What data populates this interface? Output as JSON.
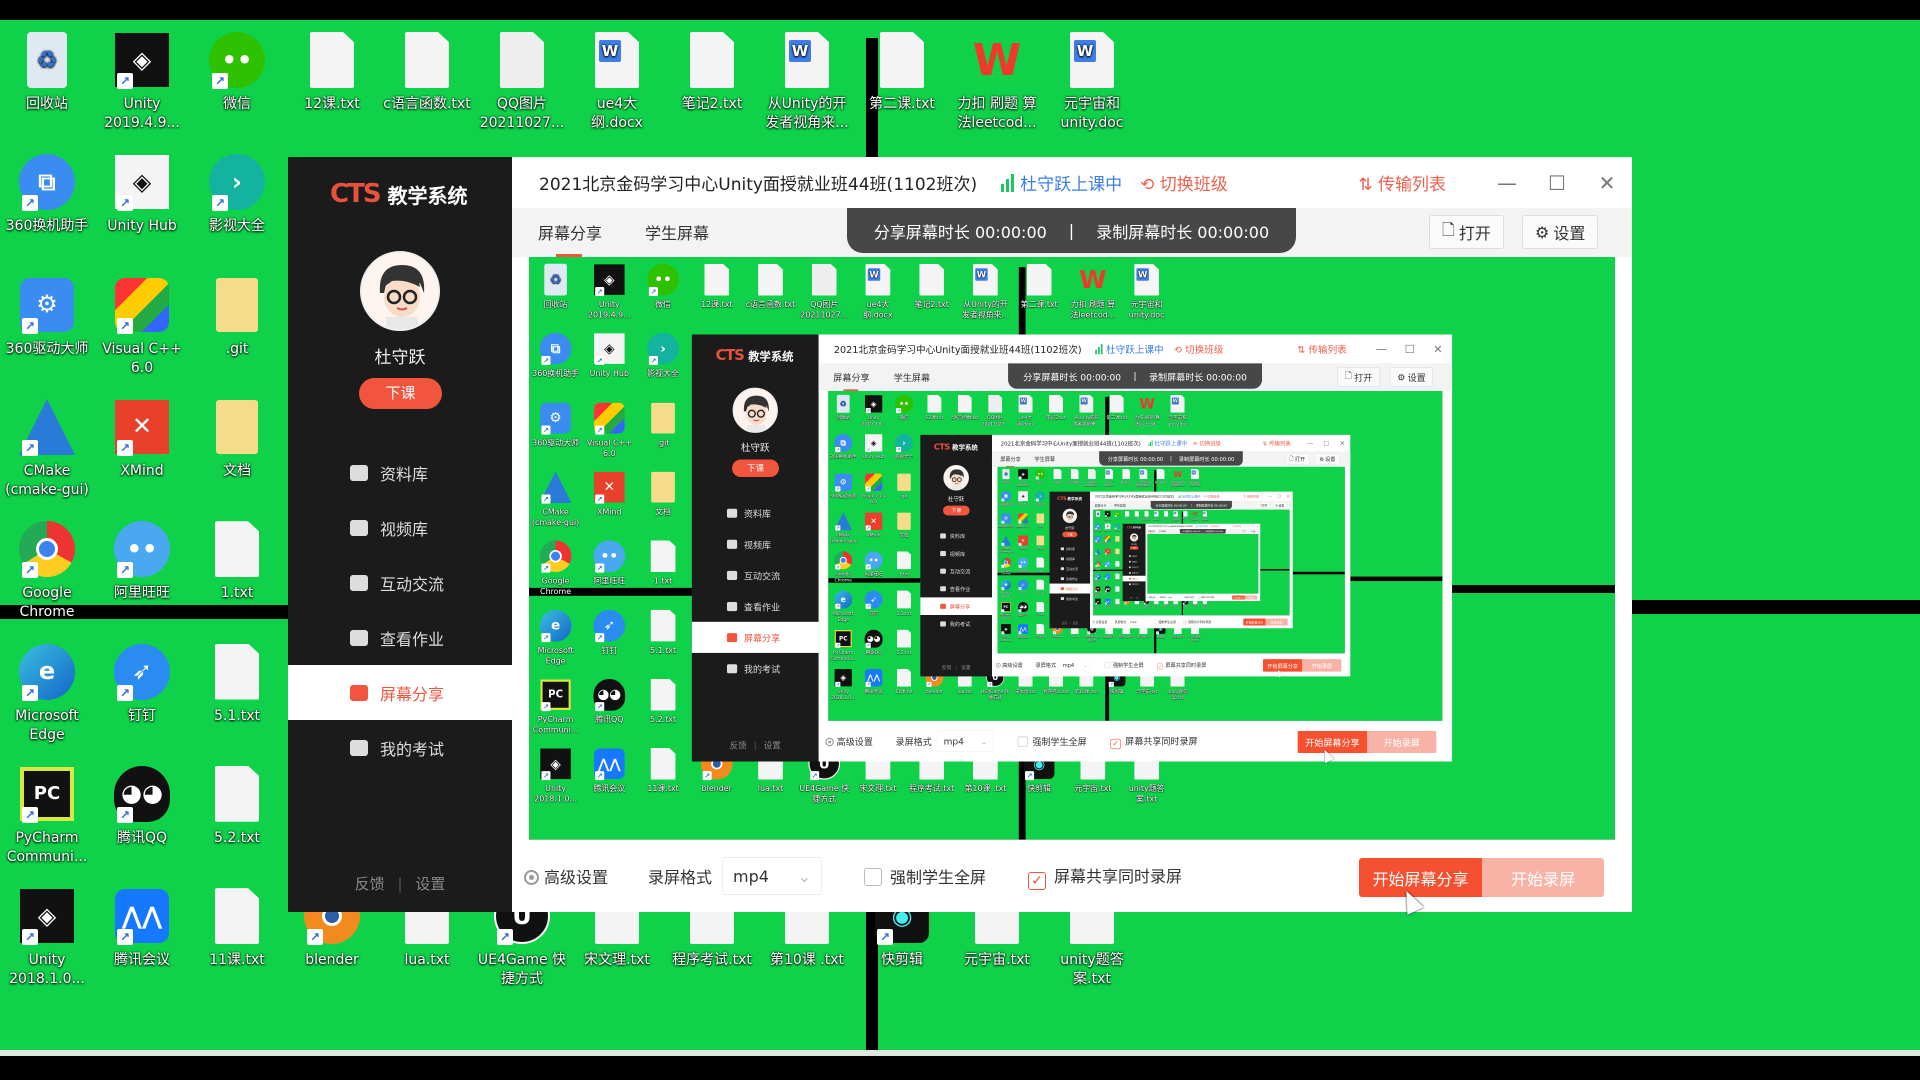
{
  "desktop": {
    "icons": [
      {
        "label": "回收站",
        "icon": "recycle-bin"
      },
      {
        "label": "360换机助手",
        "icon": "360-swap"
      },
      {
        "label": "360驱动大师",
        "icon": "360-driver"
      },
      {
        "label": "CMake (cmake-gui)",
        "icon": "cmake"
      },
      {
        "label": "Google Chrome",
        "icon": "chrome"
      },
      {
        "label": "Microsoft Edge",
        "icon": "edge"
      },
      {
        "label": "PyCharm Communi...",
        "icon": "pycharm"
      },
      {
        "label": "Unity 2018.1.0...",
        "icon": "unity"
      },
      {
        "label": "Unity 2019.4.9...",
        "icon": "unity"
      },
      {
        "label": "Unity Hub",
        "icon": "unity-hub"
      },
      {
        "label": "Visual C++ 6.0",
        "icon": "visual-cpp"
      },
      {
        "label": "XMind",
        "icon": "xmind"
      },
      {
        "label": "阿里旺旺",
        "icon": "aliwangwang"
      },
      {
        "label": "钉钉",
        "icon": "dingtalk"
      },
      {
        "label": "腾讯QQ",
        "icon": "qq"
      },
      {
        "label": "腾讯会议",
        "icon": "tencent-meeting"
      },
      {
        "label": "微信",
        "icon": "wechat"
      },
      {
        "label": "影视大全",
        "icon": "video"
      },
      {
        "label": ".git",
        "icon": "folder"
      },
      {
        "label": "文档",
        "icon": "folder"
      },
      {
        "label": "1.txt",
        "icon": "txt"
      },
      {
        "label": "5.1.txt",
        "icon": "txt"
      },
      {
        "label": "5.2.txt",
        "icon": "txt"
      },
      {
        "label": "11课.txt",
        "icon": "txt"
      },
      {
        "label": "12课.txt",
        "icon": "txt"
      },
      {
        "label": "c语言函数.txt",
        "icon": "txt"
      },
      {
        "label": "QQ图片20211027...",
        "icon": "image"
      },
      {
        "label": "ue4大纲.docx",
        "icon": "word"
      },
      {
        "label": "笔记2.txt",
        "icon": "txt"
      },
      {
        "label": "从Unity的开发者视角来...",
        "icon": "word"
      },
      {
        "label": "第二课.txt",
        "icon": "txt"
      },
      {
        "label": "力扣 刷题 算法leetcod...",
        "icon": "wps"
      },
      {
        "label": "元宇宙和unity.doc",
        "icon": "word"
      },
      {
        "label": "blender",
        "icon": "blender"
      },
      {
        "label": "lua.txt",
        "icon": "txt"
      },
      {
        "label": "UE4Game 快捷方式",
        "icon": "unreal"
      },
      {
        "label": "宋文理.txt",
        "icon": "txt"
      },
      {
        "label": "程序考试.txt",
        "icon": "txt"
      },
      {
        "label": "第10课 .txt",
        "icon": "txt"
      },
      {
        "label": "快剪辑",
        "icon": "kuaijianji"
      },
      {
        "label": "元宇宙.txt",
        "icon": "txt"
      },
      {
        "label": "unity题答案.txt",
        "icon": "txt"
      }
    ]
  },
  "app": {
    "logo_mark": "CTS",
    "logo_text": "教学系统",
    "user_name": "杜守跃",
    "end_class_label": "下课",
    "menu": [
      {
        "label": "资料库",
        "icon": "library-icon"
      },
      {
        "label": "视频库",
        "icon": "video-library-icon"
      },
      {
        "label": "互动交流",
        "icon": "chat-icon"
      },
      {
        "label": "查看作业",
        "icon": "homework-icon"
      },
      {
        "label": "屏幕分享",
        "icon": "screen-share-icon",
        "active": true
      },
      {
        "label": "我的考试",
        "icon": "exam-icon"
      }
    ],
    "footer": {
      "feedback": "反馈",
      "separator": "|",
      "settings": "设置"
    },
    "title": "2021北京金码学习中心Unity面授就业班44班(1102班次)",
    "status": "杜守跃上课中",
    "switch_class": "切换班级",
    "transfer_list": "传输列表",
    "tabs": [
      "屏幕分享",
      "学生屏幕"
    ],
    "timer": {
      "share_label": "分享屏幕时长",
      "share_value": "00:00:00",
      "sep": "|",
      "record_label": "录制屏幕时长",
      "record_value": "00:00:00"
    },
    "open_label": "打开",
    "settings_label": "设置",
    "controls": {
      "advanced": "高级设置",
      "format_label": "录屏格式",
      "format_value": "mp4",
      "force_fullscreen": "强制学生全屏",
      "force_fullscreen_checked": false,
      "record_while_sharing": "屏幕共享同时录屏",
      "record_while_sharing_checked": true,
      "start_share": "开始屏幕分享",
      "start_record": "开始录屏"
    },
    "colors": {
      "accent": "#f5502f",
      "status": "#3b7ee5",
      "desktop": "#0fd14a",
      "sidebar": "#1b1b1b"
    }
  }
}
